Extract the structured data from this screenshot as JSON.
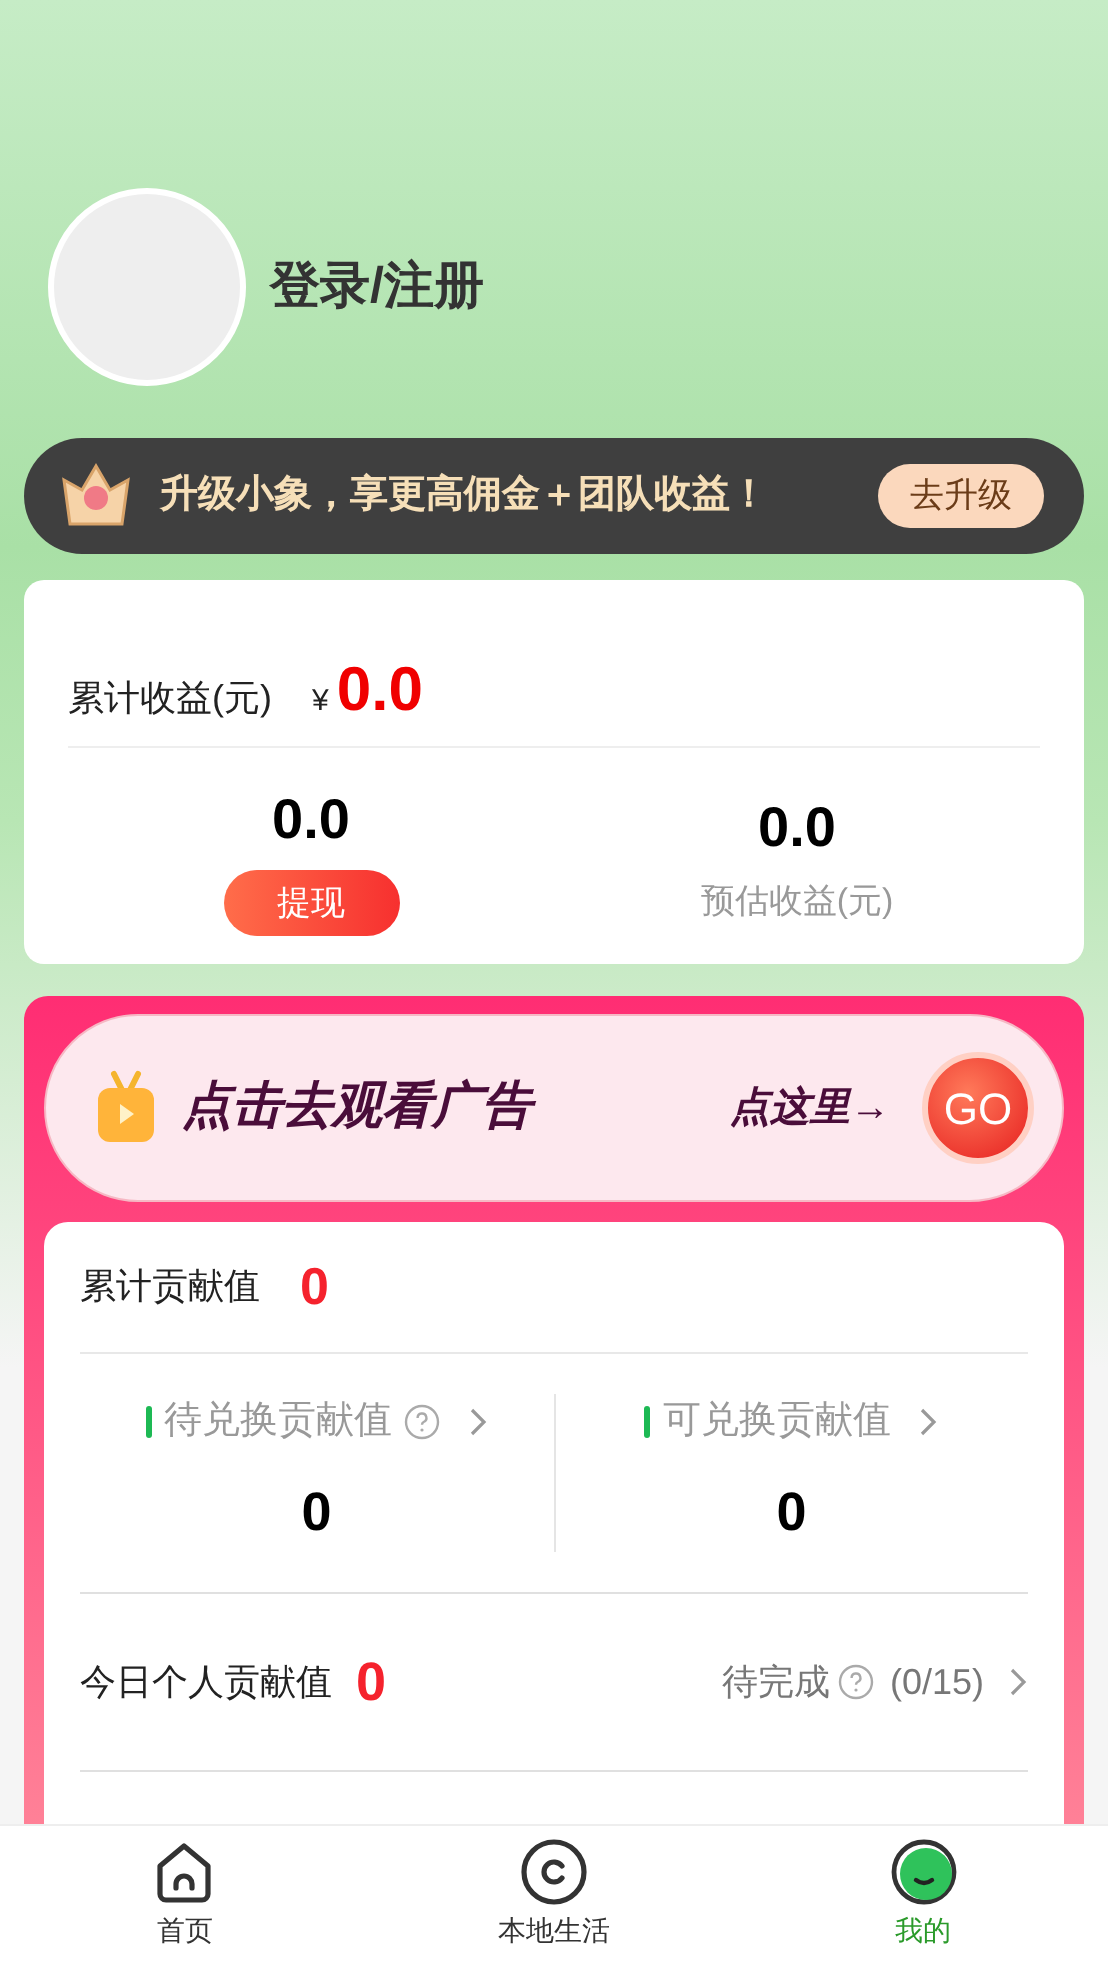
{
  "profile": {
    "login_label": "登录/注册"
  },
  "upgrade_banner": {
    "text": "升级小象，享更高佣金＋团队收益！",
    "button": "去升级"
  },
  "earnings": {
    "total_label": "累计收益(元)",
    "currency": "¥",
    "total_value": "0.0",
    "withdrawable_value": "0.0",
    "withdraw_button": "提现",
    "estimated_value": "0.0",
    "estimated_label": "预估收益(元)"
  },
  "ad_banner": {
    "title": "点击去观看广告",
    "hint": "点这里→",
    "go_button": "GO"
  },
  "contribution": {
    "total_label": "累计贡献值",
    "total_value": "0",
    "columns": [
      {
        "label": "待兑换贡献值",
        "help": true,
        "value": "0"
      },
      {
        "label": "可兑换贡献值",
        "help": false,
        "value": "0"
      }
    ],
    "today_label": "今日个人贡献值",
    "today_value": "0",
    "status": "待完成",
    "progress": "(0/15)"
  },
  "tabs": [
    {
      "label": "首页",
      "kind": "home",
      "selected": false
    },
    {
      "label": "本地生活",
      "kind": "local",
      "selected": false
    },
    {
      "label": "我的",
      "kind": "me",
      "selected": true
    }
  ]
}
